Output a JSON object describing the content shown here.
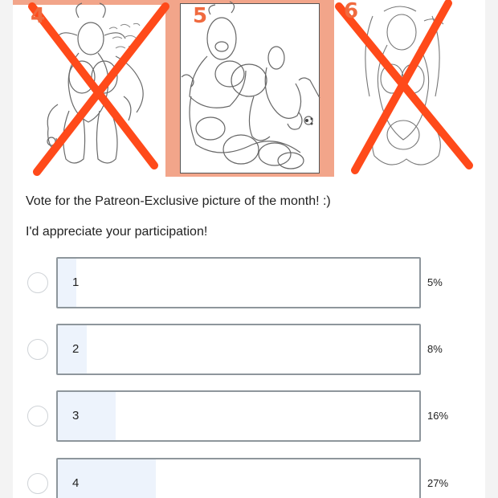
{
  "post": {
    "images": [
      {
        "label": "4",
        "crossed_out": true
      },
      {
        "label": "5",
        "crossed_out": false
      },
      {
        "label": "6",
        "crossed_out": true
      }
    ],
    "description": "Vote for the Patreon-Exclusive picture of the month! :)",
    "subtext": "I'd appreciate your participation!"
  },
  "poll": {
    "options": [
      {
        "label": "1",
        "percent_text": "5%",
        "percent": 5
      },
      {
        "label": "2",
        "percent_text": "8%",
        "percent": 8
      },
      {
        "label": "3",
        "percent_text": "16%",
        "percent": 16
      },
      {
        "label": "4",
        "percent_text": "27%",
        "percent": 27
      }
    ]
  },
  "colors": {
    "cross": "#ff4a1a",
    "frame": "#f2a58a",
    "bar_border": "#8e969c",
    "bar_fill": "#edf3fc"
  }
}
